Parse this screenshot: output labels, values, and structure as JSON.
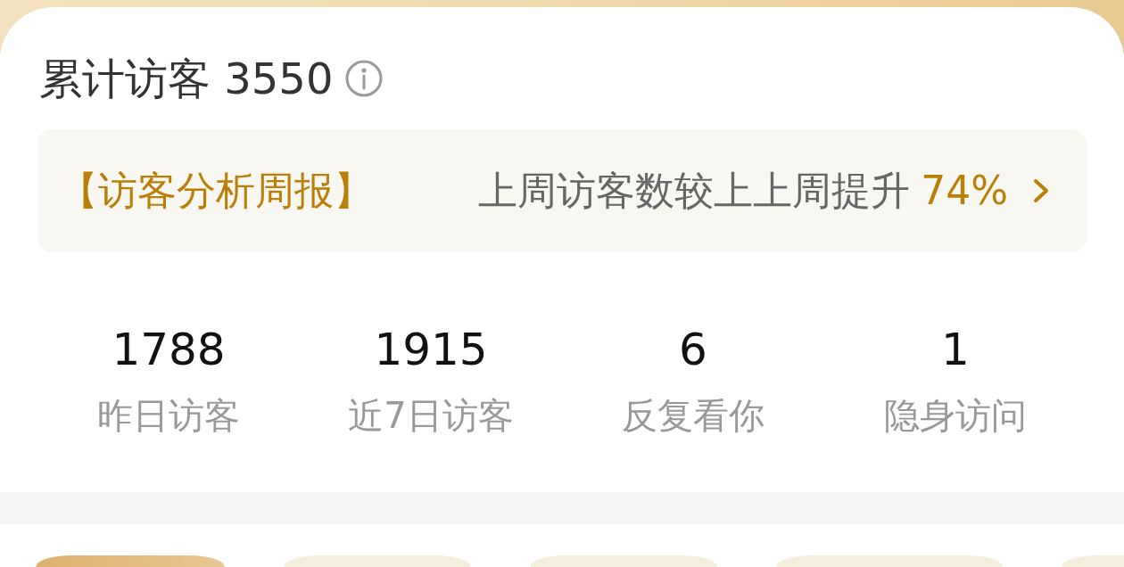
{
  "header": {
    "title": "累计访客 3550"
  },
  "weekly_report": {
    "tag": "【访客分析周报】",
    "summary": "上周访客数较上上周提升",
    "change": "74%"
  },
  "stats": [
    {
      "value": "1788",
      "label": "昨日访客"
    },
    {
      "value": "1915",
      "label": "近7日访客"
    },
    {
      "value": "6",
      "label": "反复看你"
    },
    {
      "value": "1",
      "label": "隐身访问"
    }
  ],
  "filter_chips": [
    {
      "selected": true
    },
    {
      "selected": false
    },
    {
      "selected": false
    },
    {
      "selected": false
    },
    {
      "selected": false
    }
  ]
}
